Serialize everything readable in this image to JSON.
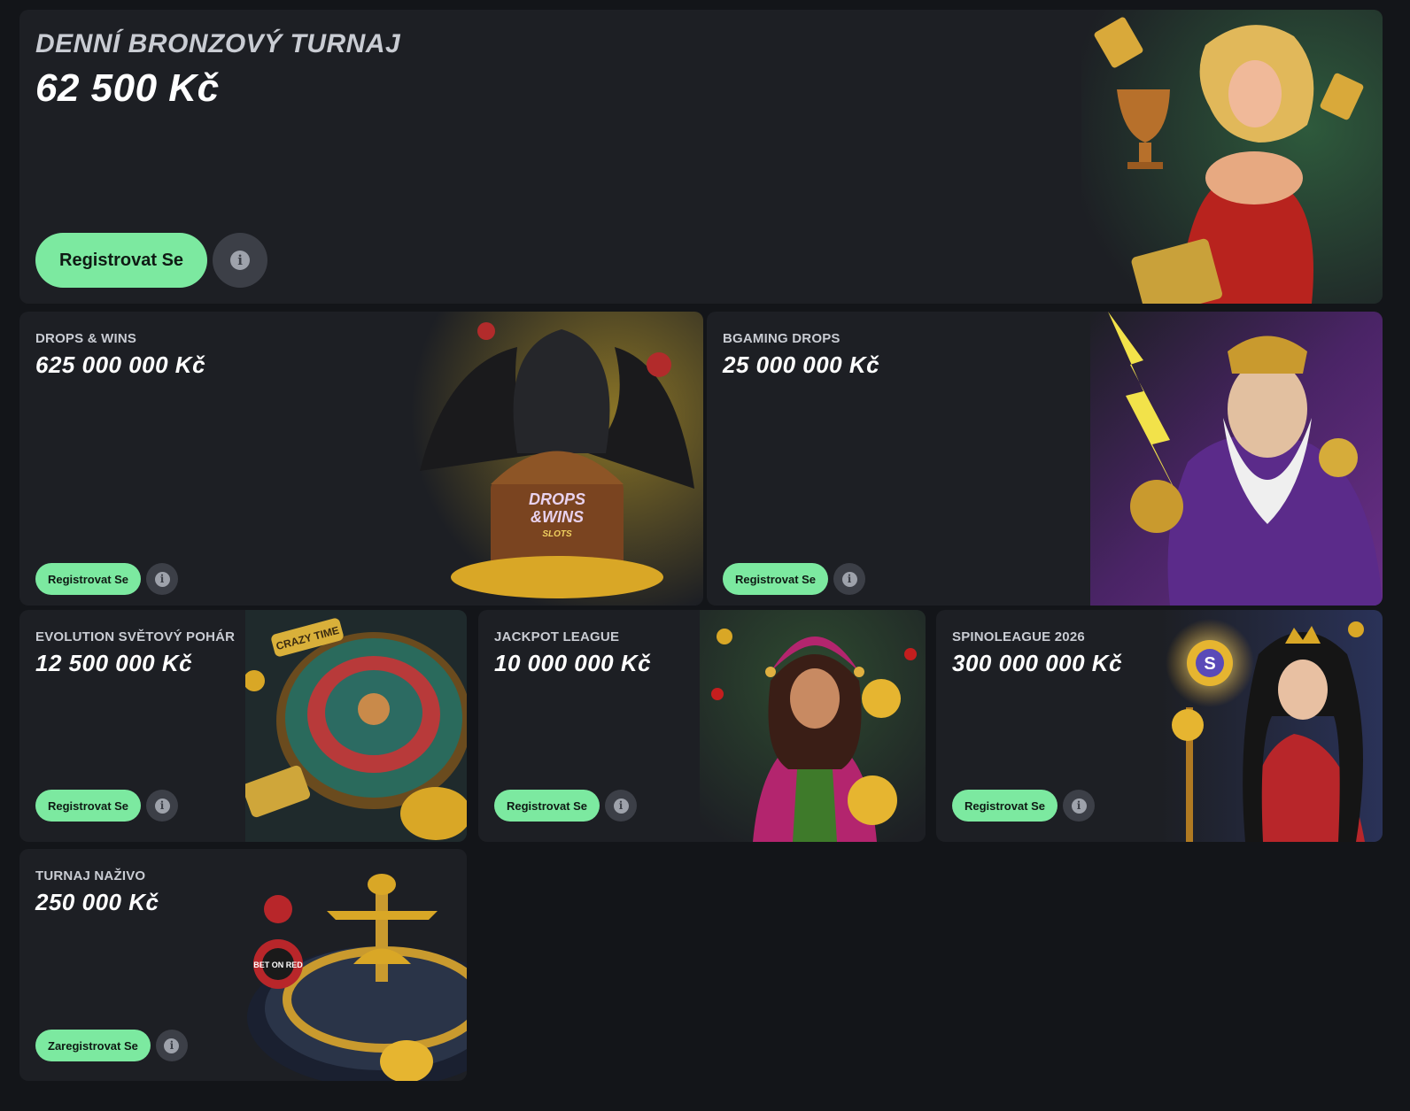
{
  "tournaments": [
    {
      "category": "DENNÍ BRONZOVÝ TURNAJ",
      "amount": "62 500 Kč",
      "button": "Registrovat Se",
      "art": "trophy-woman-illustration"
    },
    {
      "category": "DROPS & WINS",
      "amount": "625 000 000 Kč",
      "button": "Registrovat Se",
      "art": "dragon-treasure-illustration",
      "art_text": "DROPS & WINS SLOTS"
    },
    {
      "category": "BGAMING DROPS",
      "amount": "25 000 000 Kč",
      "button": "Registrovat Se",
      "art": "lightning-god-illustration"
    },
    {
      "category": "EVOLUTION SVĚTOVÝ POHÁR",
      "amount": "12 500 000 Kč",
      "button": "Registrovat Se",
      "art": "roulette-wheel-illustration",
      "art_text": "CRAZY TIME"
    },
    {
      "category": "JACKPOT LEAGUE",
      "amount": "10 000 000 Kč",
      "button": "Registrovat Se",
      "art": "jester-woman-illustration"
    },
    {
      "category": "SPINOLEAGUE 2026",
      "amount": "300 000 000 Kč",
      "button": "Registrovat Se",
      "art": "queen-staff-illustration"
    },
    {
      "category": "TURNAJ NAŽIVO",
      "amount": "250 000 Kč",
      "button": "Zaregistrovat Se",
      "art": "live-roulette-illustration",
      "art_text": "BET ON RED"
    }
  ],
  "info_icon": "info-icon",
  "colors": {
    "page_bg": "#131519",
    "card_bg": "#1d1f24",
    "button_bg": "#7ce9a0",
    "info_bg": "#3c3f47"
  }
}
